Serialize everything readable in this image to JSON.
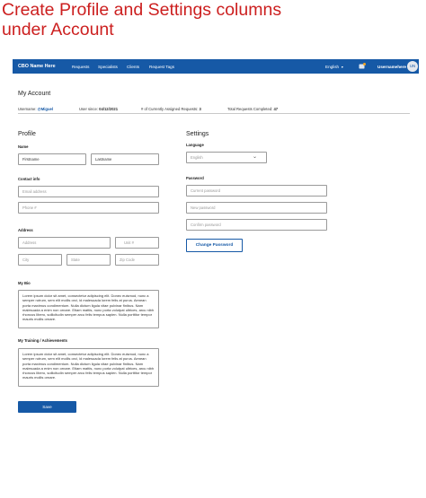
{
  "headline": {
    "line1": "Create Profile and Settings columns",
    "line2": "under Account"
  },
  "navbar": {
    "brand": "CBO Name Here",
    "links": [
      "Requests",
      "Specialists",
      "Clients",
      "Request Tags"
    ],
    "language": "English",
    "username": "Usernamehere",
    "avatar_initials": "UN",
    "bar_color": "#1659a6",
    "notification_color": "#f4a522"
  },
  "account": {
    "title": "My Account",
    "username_label": "Username:",
    "username_value": "@Miguel",
    "user_since_label": "User since:",
    "user_since_value": "04/12/2021",
    "assigned_label": "# of Currently Assigned Requests:",
    "assigned_value": "3",
    "completed_label": "Total Requests Completed:",
    "completed_value": "47"
  },
  "profile": {
    "title": "Profile",
    "name_label": "Name",
    "firstname_placeholder": "Firstname",
    "lastname_placeholder": "Lastname",
    "contact_label": "Contact info",
    "email_placeholder": "Email address",
    "phone_placeholder": "Phone #",
    "address_label": "Address",
    "address_placeholder": "Address",
    "unit_placeholder": "Unit #",
    "city_placeholder": "City",
    "state_placeholder": "State",
    "zip_placeholder": "Zip Code",
    "bio_label": "My Bio",
    "bio_text": "Lorem ipsum dolor sit amet, consectetur adipiscing elit. Donec euismod, nunc a semper rutrum, sem elit mollis orci, id malesuada lorem felis at purus. Aenean porta maximus condimentum. Nulla dictum ligula vitae pulvinar finibus. Nam malesuada a enim non ornare. Etiam mattis, nunc porta volutpat ultrices, arcu nibh rhoncus libero, sollicitudin semper arcu felis tempus sapien. Nulla porttitor tempor mauris mollis ornare.",
    "training_label": "My Training / Achievements",
    "training_text": "Lorem ipsum dolor sit amet, consectetur adipiscing elit. Donec euismod, nunc a semper rutrum, sem elit mollis orci, id malesuada lorem felis at purus. Aenean porta maximus condimentum. Nulla dictum ligula vitae pulvinar finibus. Nam malesuada a enim non ornare. Etiam mattis, nunc porta volutpat ultrices, arcu nibh rhoncus libero, sollicitudin semper arcu felis tempus sapien. Nulla porttitor tempor mauris mollis ornare.",
    "save_label": "Save"
  },
  "settings": {
    "title": "Settings",
    "language_label": "Language",
    "language_value": "English",
    "password_label": "Password",
    "current_password_placeholder": "Current password",
    "new_password_placeholder": "New password",
    "confirm_password_placeholder": "Confirm password",
    "change_password_label": "Change Password"
  }
}
